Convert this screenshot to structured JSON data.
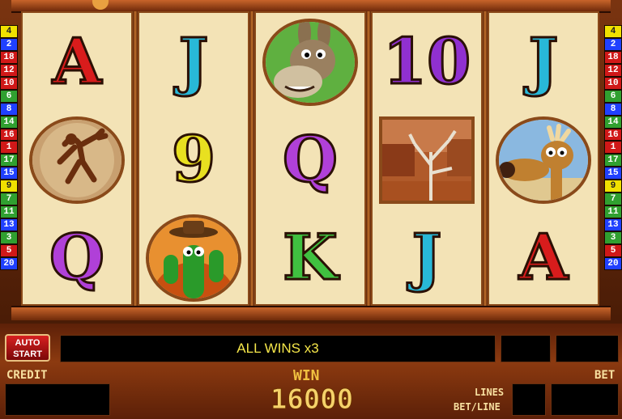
{
  "paylines_left": [
    "4",
    "2",
    "18",
    "12",
    "10",
    "6",
    "8",
    "14",
    "16",
    "1",
    "17",
    "15",
    "9",
    "7",
    "11",
    "13",
    "3",
    "5",
    "20"
  ],
  "paylines_right": [
    "4",
    "2",
    "18",
    "12",
    "10",
    "6",
    "8",
    "14",
    "16",
    "1",
    "17",
    "15",
    "9",
    "7",
    "11",
    "13",
    "3",
    "5",
    "20"
  ],
  "line_colors": [
    "#f0e000",
    "#2040ff",
    "#d01818",
    "#d01818",
    "#d01818",
    "#30a030",
    "#2040ff",
    "#30a030",
    "#d01818",
    "#d01818",
    "#30a030",
    "#2040ff",
    "#f0e000",
    "#30a030",
    "#30a030",
    "#2040ff",
    "#30a030",
    "#d01818",
    "#2040ff"
  ],
  "reels": [
    [
      {
        "type": "letter",
        "text": "A",
        "color": "#d81c1c"
      },
      {
        "type": "icon",
        "name": "kokopelli-icon"
      },
      {
        "type": "letter",
        "text": "Q",
        "color": "#b040d8"
      }
    ],
    [
      {
        "type": "letter",
        "text": "J",
        "color": "#28b8d8"
      },
      {
        "type": "letter",
        "text": "9",
        "color": "#e8e020"
      },
      {
        "type": "icon",
        "name": "cactus-icon"
      }
    ],
    [
      {
        "type": "icon",
        "name": "donkey-icon"
      },
      {
        "type": "letter",
        "text": "Q",
        "color": "#b040d8"
      },
      {
        "type": "letter",
        "text": "K",
        "color": "#40c040"
      }
    ],
    [
      {
        "type": "letter",
        "text": "10",
        "color": "#9030d0"
      },
      {
        "type": "icon",
        "name": "canyon-tree-icon"
      },
      {
        "type": "letter",
        "text": "J",
        "color": "#28b8d8"
      }
    ],
    [
      {
        "type": "letter",
        "text": "J",
        "color": "#28b8d8"
      },
      {
        "type": "icon",
        "name": "moose-icon"
      },
      {
        "type": "letter",
        "text": "A",
        "color": "#d81c1c"
      }
    ]
  ],
  "controls": {
    "auto_start": "AUTO START",
    "message": "ALL WINS x3",
    "credit_label": "CREDIT",
    "win_label": "WIN",
    "win_value": "16000",
    "lines_label": "LINES",
    "betline_label": "BET/LINE",
    "bet_label": "BET"
  }
}
